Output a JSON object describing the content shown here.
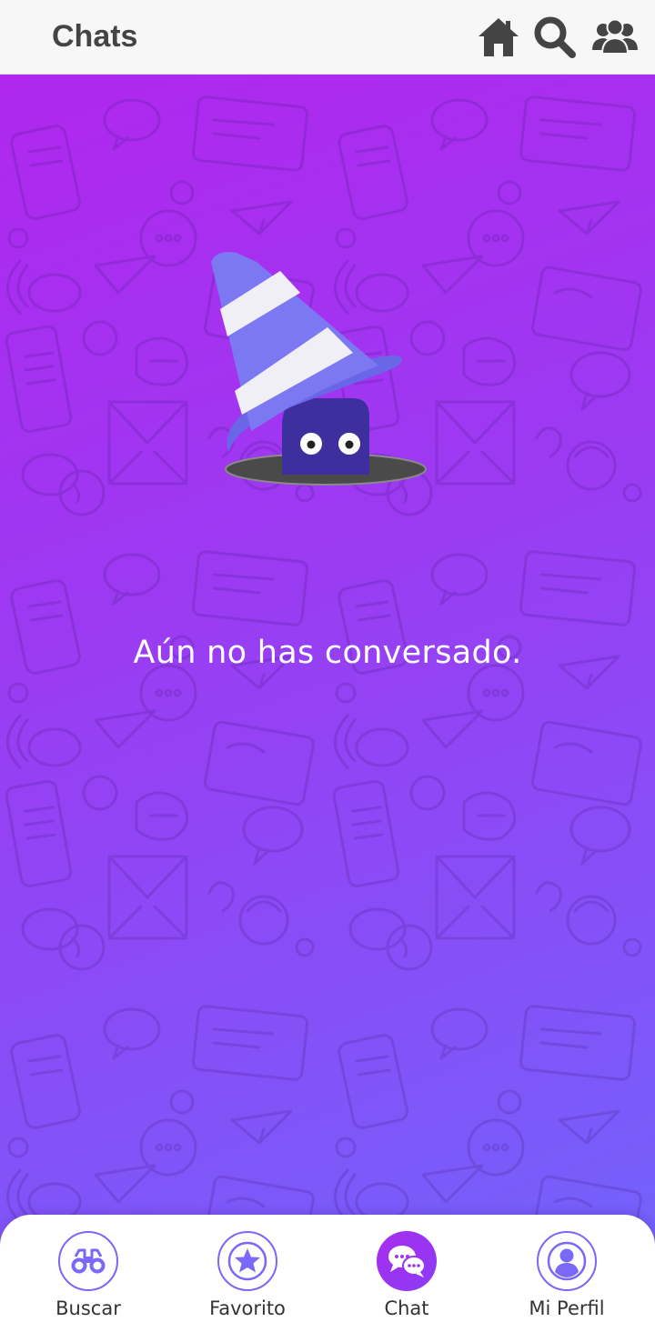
{
  "header": {
    "title": "Chats",
    "icons": [
      "home-icon",
      "search-icon",
      "users-icon"
    ]
  },
  "main": {
    "empty_message": "Aún no has conversado."
  },
  "bottom_nav": {
    "items": [
      {
        "label": "Buscar",
        "icon": "binoculars-icon",
        "active": false
      },
      {
        "label": "Favorito",
        "icon": "star-icon",
        "active": false
      },
      {
        "label": "Chat",
        "icon": "chat-bubbles-icon",
        "active": true
      },
      {
        "label": "Mi Perfil",
        "icon": "profile-icon",
        "active": false
      }
    ]
  },
  "colors": {
    "accent": "#7a68f6",
    "gradient_start": "#b027ee",
    "gradient_end": "#6e66fb",
    "header_bg": "#f7f7f7",
    "header_text": "#444444"
  }
}
